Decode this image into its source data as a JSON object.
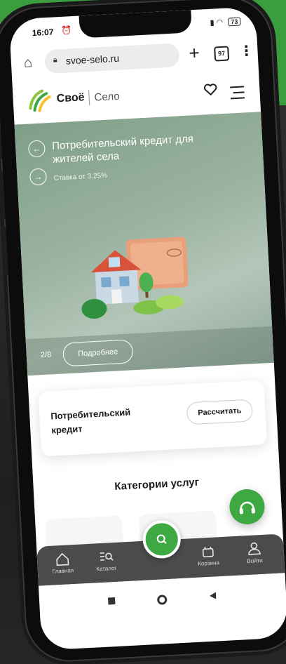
{
  "status_bar": {
    "time": "16:07",
    "battery": "73"
  },
  "browser": {
    "url": "svoe-selo.ru",
    "tab_count": "97"
  },
  "site": {
    "brand": "Своё",
    "brand_sub": "Село"
  },
  "hero": {
    "title": "Потребительский кредит для жителей села",
    "subtitle": "Ставка от 3,25%",
    "counter": "2/8",
    "more_label": "Подробнее"
  },
  "loan_card": {
    "title": "Потребительский кредит",
    "button_label": "Рассчитать"
  },
  "categories": {
    "title": "Категории услуг"
  },
  "bottom_nav": {
    "items": [
      {
        "label": "Главная",
        "icon": "home-icon"
      },
      {
        "label": "Каталог",
        "icon": "catalog-icon"
      },
      {
        "label": "Корзина",
        "icon": "cart-icon"
      },
      {
        "label": "Войти",
        "icon": "user-icon"
      }
    ]
  },
  "colors": {
    "brand_green": "#3ea842",
    "background_green": "#3a9e3f",
    "nav_bg": "#4b4b4b"
  }
}
